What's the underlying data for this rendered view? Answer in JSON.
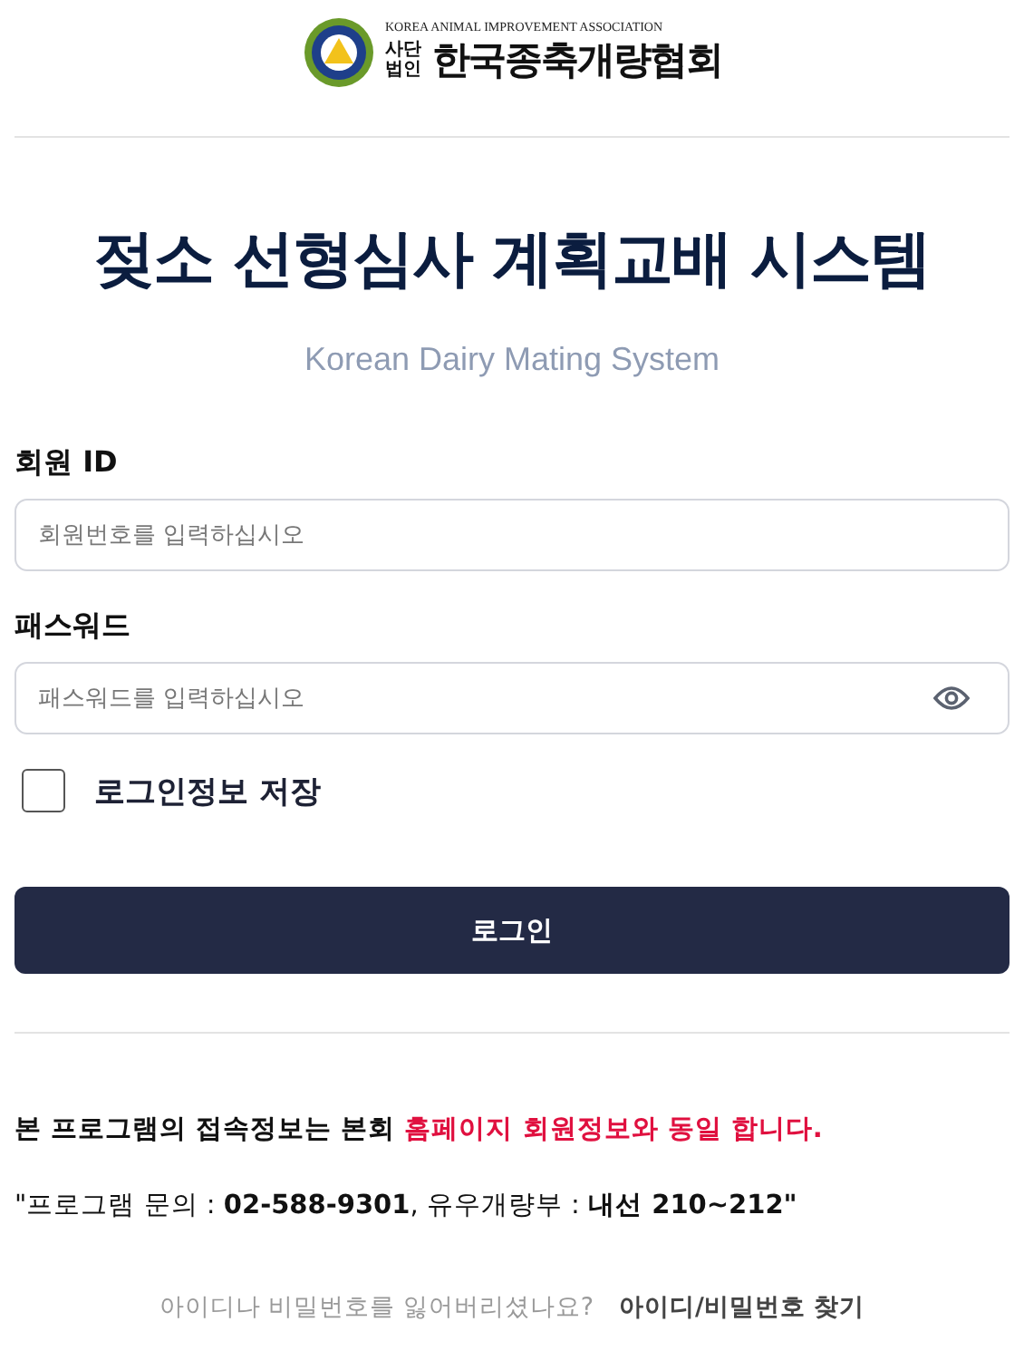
{
  "logo": {
    "english": "KOREA ANIMAL IMPROVEMENT ASSOCIATION",
    "prefix": "사단 법인",
    "name": "한국종축개량협회"
  },
  "title": "젖소 선형심사 계획교배 시스템",
  "subtitle": "Korean Dairy Mating System",
  "fields": [
    {
      "label": "회원 ID",
      "placeholder": "회원번호를 입력하십시오",
      "kind": "text"
    },
    {
      "label": "패스워드",
      "placeholder": "패스워드를 입력하십시오",
      "kind": "password"
    }
  ],
  "remember": {
    "label": "로그인정보 저장",
    "checked": false
  },
  "login_button": "로그인",
  "notice": [
    {
      "text": "본 프로그램의 접속정보는 본회 ",
      "highlight": false
    },
    {
      "text": "홈페이지 회원정보와 동일 합니다.",
      "highlight": true
    }
  ],
  "contact": "\"프로그램 문의 : **02-588-9301**, 유우개량부 : **내선 210~212\"**",
  "help": {
    "question": "아이디나 비밀번호를 잃어버리셨나요?",
    "link": "아이디/비밀번호 찾기"
  }
}
